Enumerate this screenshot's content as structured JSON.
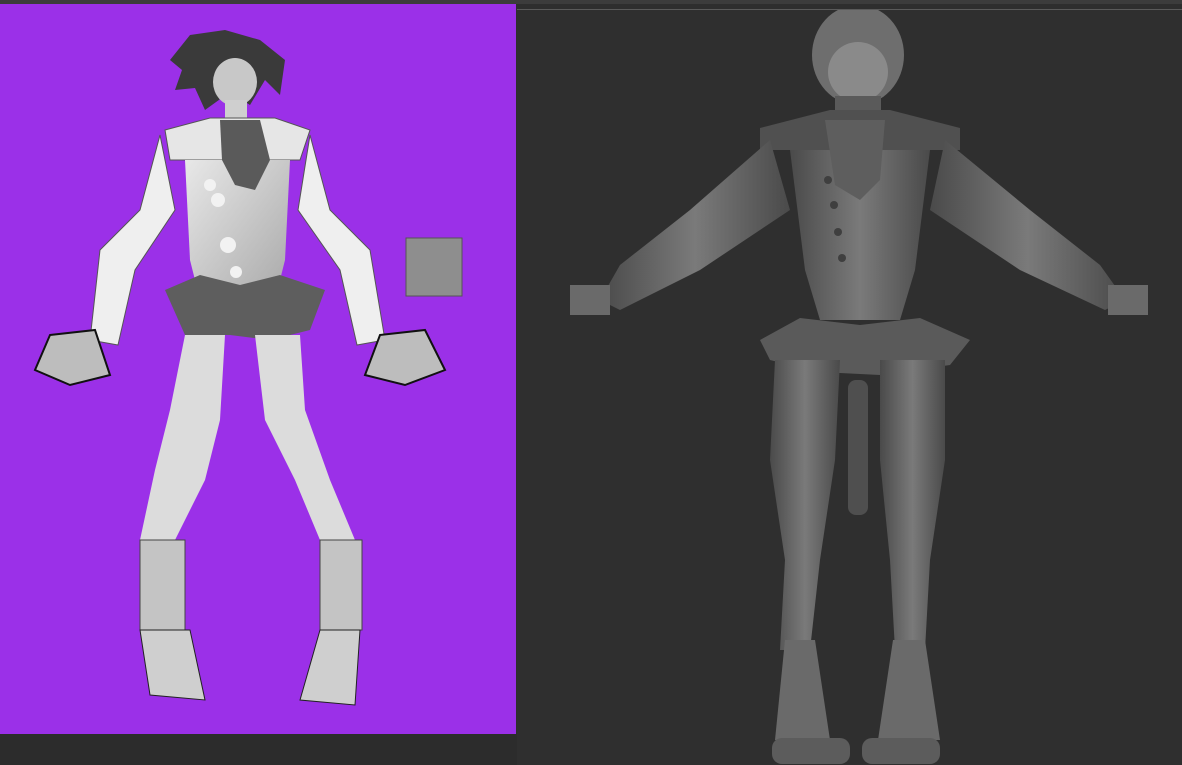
{
  "left_panel": {
    "background_color": "#9b30e8",
    "subject": "concept-sketch-character"
  },
  "right_panel": {
    "background_color": "#2f2f2f",
    "subject": "sculpt-model-character"
  }
}
